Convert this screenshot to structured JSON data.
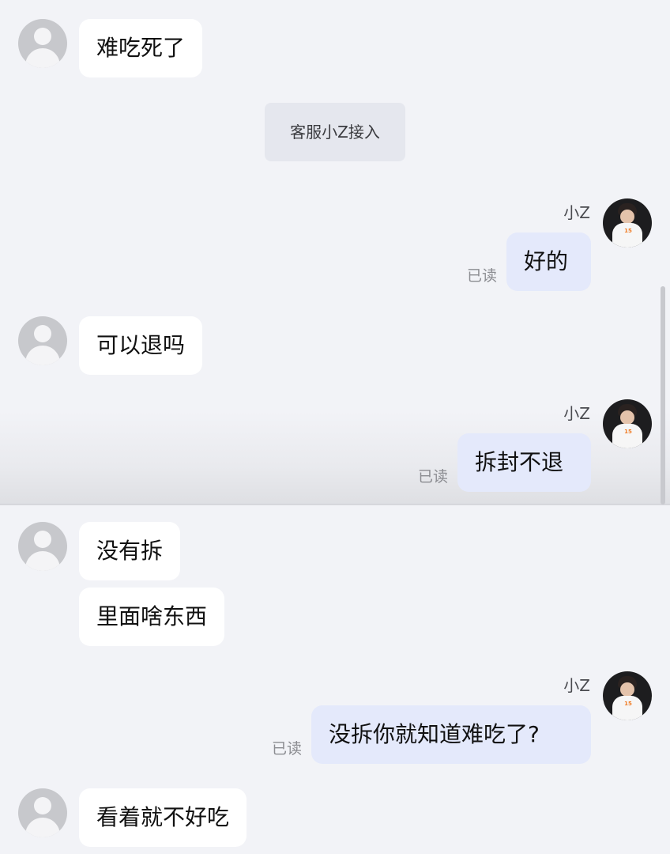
{
  "messages": [
    {
      "type": "incoming",
      "text": "难吃死了"
    },
    {
      "type": "system",
      "text": "客服小Z接入"
    },
    {
      "type": "outgoing",
      "sender": "小Z",
      "text": "好的",
      "status": "已读"
    },
    {
      "type": "incoming",
      "text": "可以退吗"
    },
    {
      "type": "outgoing",
      "sender": "小Z",
      "text": "拆封不退",
      "status": "已读"
    },
    {
      "type": "incoming",
      "text": "没有拆"
    },
    {
      "type": "incoming",
      "text": "里面啥东西"
    },
    {
      "type": "outgoing",
      "sender": "小Z",
      "text": "没拆你就知道难吃了?",
      "status": "已读"
    },
    {
      "type": "incoming",
      "text": "看着就不好吃"
    }
  ],
  "agent_avatar": {
    "jersey_number": "15",
    "jersey_color": "#f07b22"
  },
  "colors": {
    "incoming_bubble": "#ffffff",
    "outgoing_bubble": "#e4e9fb",
    "background": "#f2f3f7"
  }
}
